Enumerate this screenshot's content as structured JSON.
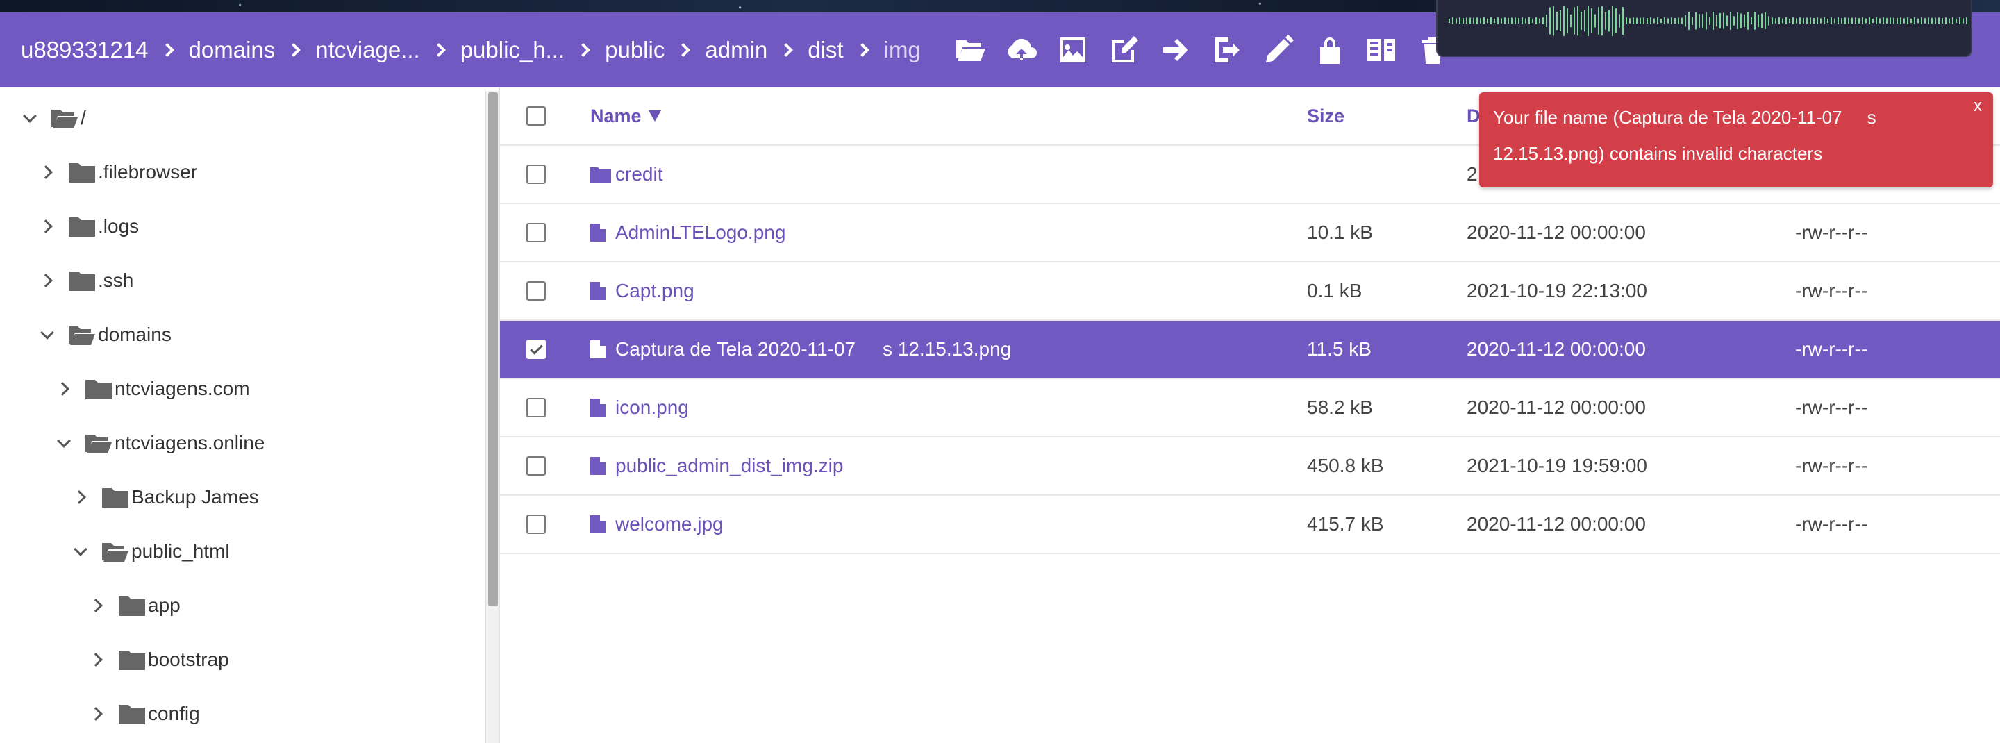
{
  "breadcrumb": [
    "u889331214",
    "domains",
    "ntcviage...",
    "public_h...",
    "public",
    "admin",
    "dist",
    "img"
  ],
  "toolbar_icons": [
    "folder-open-icon",
    "cloud-upload-icon",
    "image-icon",
    "edit-icon",
    "move-icon",
    "logout-icon",
    "pencil-icon",
    "lock-icon",
    "archive-icon",
    "trash-icon"
  ],
  "colors": {
    "accent": "#7159c1",
    "error": "#d33f49"
  },
  "tree": [
    {
      "label": "/",
      "expanded": true
    },
    {
      "label": ".filebrowser",
      "expanded": false
    },
    {
      "label": ".logs",
      "expanded": false
    },
    {
      "label": ".ssh",
      "expanded": false
    },
    {
      "label": "domains",
      "expanded": true
    },
    {
      "label": "ntcviagens.com",
      "expanded": false
    },
    {
      "label": "ntcviagens.online",
      "expanded": true
    },
    {
      "label": "Backup James",
      "expanded": false
    },
    {
      "label": "public_html",
      "expanded": true
    },
    {
      "label": "app",
      "expanded": false
    },
    {
      "label": "bootstrap",
      "expanded": false
    },
    {
      "label": "config",
      "expanded": false
    }
  ],
  "list": {
    "headers": {
      "name": "Name",
      "size": "Size",
      "date": "D"
    },
    "rows": [
      {
        "name": "credit",
        "type": "folder",
        "size": "",
        "date": "2",
        "perm": "",
        "checked": false
      },
      {
        "name": "AdminLTELogo.png",
        "type": "file",
        "size": "10.1 kB",
        "date": "2020-11-12 00:00:00",
        "perm": "-rw-r--r--",
        "checked": false
      },
      {
        "name": "Capt.png",
        "type": "file",
        "size": "0.1 kB",
        "date": "2021-10-19 22:13:00",
        "perm": "-rw-r--r--",
        "checked": false
      },
      {
        "name": "Captura de Tela 2020-11-07     s 12.15.13.png",
        "type": "file",
        "size": "11.5 kB",
        "date": "2020-11-12 00:00:00",
        "perm": "-rw-r--r--",
        "checked": true
      },
      {
        "name": "icon.png",
        "type": "file",
        "size": "58.2 kB",
        "date": "2020-11-12 00:00:00",
        "perm": "-rw-r--r--",
        "checked": false
      },
      {
        "name": "public_admin_dist_img.zip",
        "type": "file",
        "size": "450.8 kB",
        "date": "2021-10-19 19:59:00",
        "perm": "-rw-r--r--",
        "checked": false
      },
      {
        "name": "welcome.jpg",
        "type": "file",
        "size": "415.7 kB",
        "date": "2020-11-12 00:00:00",
        "perm": "-rw-r--r--",
        "checked": false
      }
    ]
  },
  "toast": {
    "message": "Your file name (Captura de Tela 2020-11-07     s 12.15.13.png) contains invalid characters",
    "close_label": "x"
  }
}
